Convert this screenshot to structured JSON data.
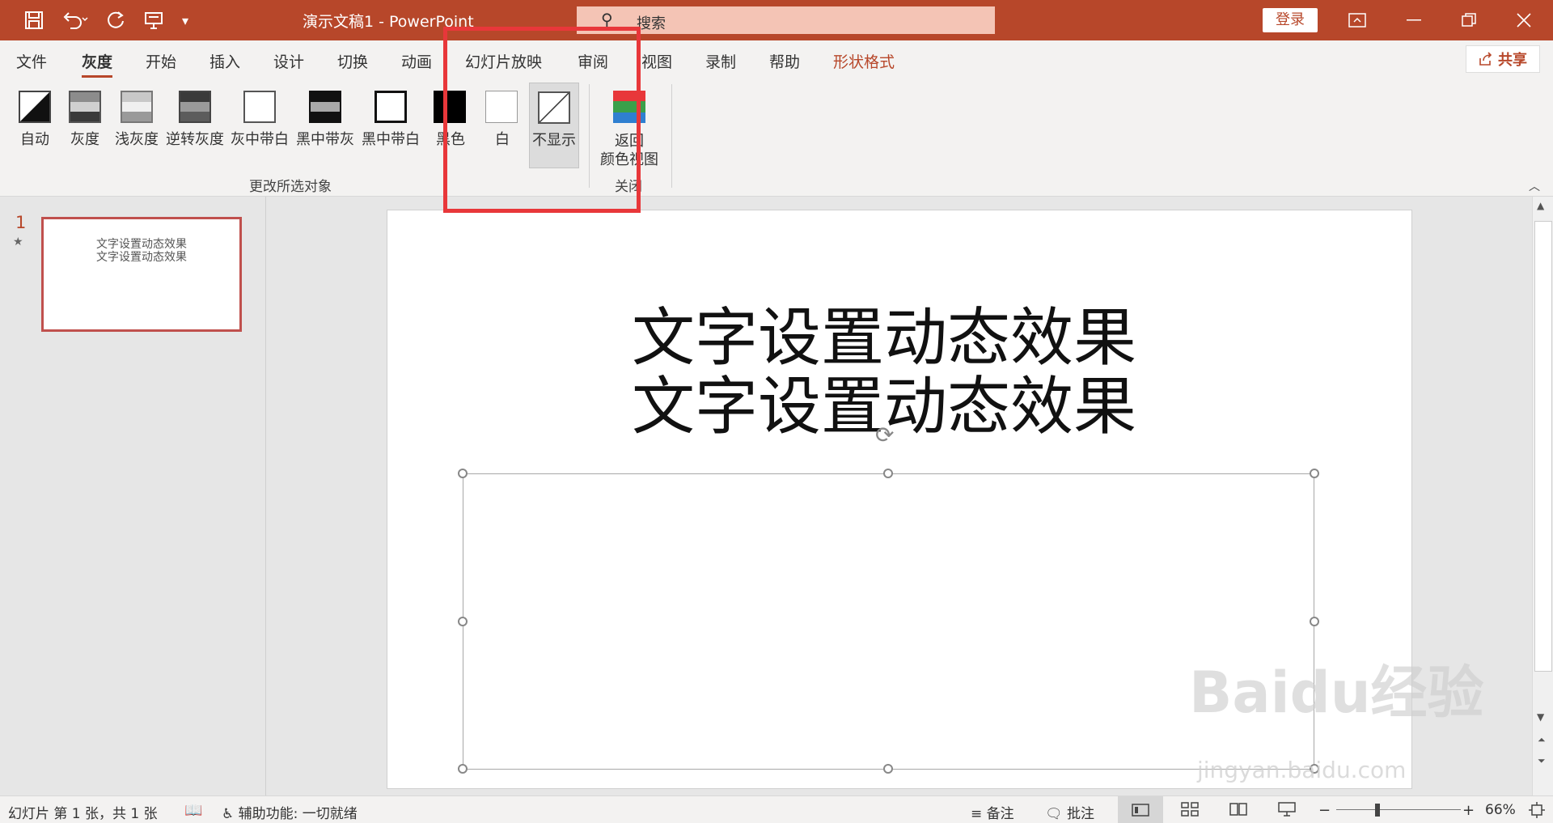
{
  "titlebar": {
    "doc_title": "演示文稿1  -  PowerPoint",
    "search_placeholder": "搜索",
    "login_label": "登录",
    "bg_color": "#b7472a"
  },
  "tabs": [
    "文件",
    "灰度",
    "开始",
    "插入",
    "设计",
    "切换",
    "动画",
    "幻灯片放映",
    "审阅",
    "视图",
    "录制",
    "帮助",
    "形状格式"
  ],
  "active_tab": "灰度",
  "share_label": "共享",
  "ribbon": {
    "buttons": [
      "自动",
      "灰度",
      "浅灰度",
      "逆转灰度",
      "灰中带白",
      "黑中带灰",
      "黑中带白",
      "黑色",
      "白",
      "不显示"
    ],
    "selected_button": "不显示",
    "group_label": "更改所选对象",
    "return_label_line1": "返回",
    "return_label_line2": "颜色视图",
    "close_group_label": "关闭"
  },
  "slides_panel": {
    "slide_number": "1",
    "thumb_line1": "文字设置动态效果",
    "thumb_line2": "文字设置动态效果"
  },
  "slide": {
    "line1": "文字设置动态效果",
    "line2": "文字设置动态效果"
  },
  "statusbar": {
    "slide_info": "幻灯片 第 1 张，共 1 张",
    "accessibility": "辅助功能: 一切就绪",
    "notes": "备注",
    "comments": "批注",
    "zoom_minus": "−",
    "zoom_plus": "+",
    "zoom": "66%",
    "zoom_level_fraction": 0.33
  },
  "watermark": {
    "main": "Baidu经验",
    "sub": "jingyan.baidu.com"
  },
  "accent_color": "#b7472a",
  "highlight_color": "#e8373a"
}
